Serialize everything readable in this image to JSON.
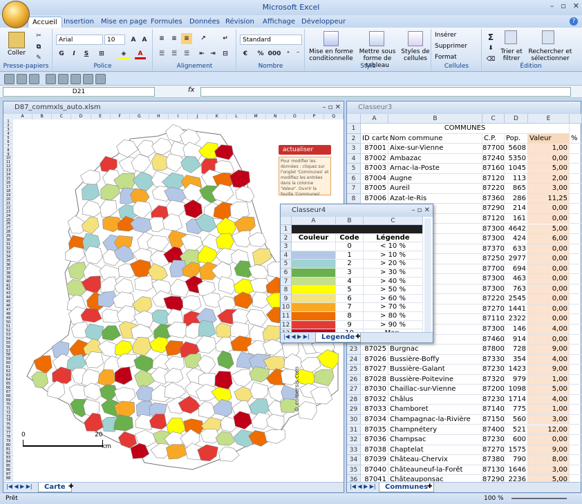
{
  "app": {
    "title": "Microsoft Excel"
  },
  "ribbon_tabs": [
    "Accueil",
    "Insertion",
    "Mise en page",
    "Formules",
    "Données",
    "Révision",
    "Affichage",
    "Développeur"
  ],
  "ribbon": {
    "clipboard": {
      "paste": "Coller",
      "label": "Presse-papiers"
    },
    "font": {
      "name": "Arial",
      "size": "10",
      "label": "Police",
      "bold": "G",
      "italic": "I",
      "underline": "S"
    },
    "alignment": {
      "label": "Alignement"
    },
    "number": {
      "format": "Standard",
      "label": "Nombre",
      "percent": "%",
      "thousands": "000"
    },
    "style": {
      "cond_format": "Mise en forme conditionnelle",
      "table_format": "Mettre sous forme de tableau",
      "cell_styles": "Styles de cellules",
      "label": "Style"
    },
    "cells": {
      "insert": "Insérer",
      "delete": "Supprimer",
      "format": "Format",
      "label": "Cellules"
    },
    "editing": {
      "sort": "Trier et filtrer",
      "find": "Rechercher et sélectionner",
      "sum": "Σ",
      "label": "Édition"
    }
  },
  "formula_bar": {
    "name_box": "D21",
    "fx": "fx"
  },
  "map_window": {
    "title": "D87_commxls_auto.xlsm",
    "sheet_tab": "Carte",
    "refresh_button": "actualiser",
    "refresh_note": "Pour modifier les données : cliquez sur l'onglet 'Communes' et modifiez les entrées dans la colonne 'Valeur'. Ouvrir la feuille 'Communes'",
    "scale": {
      "zero": "0",
      "twenty": "20",
      "unit": "km"
    },
    "copyright": "© comersis.com",
    "columns": [
      "A",
      "B",
      "C",
      "D",
      "E",
      "F",
      "G",
      "H",
      "I",
      "J",
      "K",
      "L",
      "M",
      "N",
      "O",
      "P",
      "Q"
    ],
    "rows": [
      "1",
      "2",
      "3",
      "4",
      "5",
      "6",
      "7",
      "8",
      "9",
      "10",
      "11",
      "12",
      "13",
      "14",
      "15",
      "16",
      "17",
      "18",
      "19",
      "20",
      "21",
      "22",
      "23",
      "24",
      "25",
      "26",
      "27",
      "28",
      "29",
      "30",
      "31",
      "32",
      "33",
      "34",
      "35",
      "36",
      "37",
      "38",
      "39",
      "40",
      "41",
      "42",
      "43",
      "44",
      "45",
      "46",
      "47",
      "48",
      "49",
      "50",
      "51",
      "52",
      "53",
      "54",
      "55",
      "56",
      "57",
      "58",
      "59",
      "60",
      "61",
      "62",
      "63",
      "64",
      "65",
      "66",
      "67",
      "68",
      "69",
      "70",
      "71",
      "72",
      "73",
      "74",
      "75",
      "76",
      "77",
      "78",
      "79",
      "80",
      "81",
      "82",
      "83",
      "84",
      "85",
      "86",
      "87",
      "88"
    ]
  },
  "communes_window": {
    "title": "Classeur3",
    "sheet_tab": "Communes",
    "columns": [
      "A",
      "B",
      "C",
      "D",
      "E"
    ],
    "title_row": "COMMUNES",
    "headers": [
      "ID carte",
      "Nom commune",
      "C.P.",
      "Pop.",
      "Valeur",
      "%"
    ],
    "rows": [
      [
        "3",
        "87001",
        "Aixe-sur-Vienne",
        "87700",
        "5608",
        "1,00"
      ],
      [
        "4",
        "87002",
        "Ambazac",
        "87240",
        "5350",
        "0,00"
      ],
      [
        "5",
        "87003",
        "Arnac-la-Poste",
        "87160",
        "1045",
        "5,00"
      ],
      [
        "6",
        "87004",
        "Augne",
        "87120",
        "113",
        "2,00"
      ],
      [
        "7",
        "87005",
        "Aureil",
        "87220",
        "865",
        "3,00"
      ],
      [
        "8",
        "87006",
        "Azat-le-Ris",
        "87360",
        "286",
        "11,25"
      ],
      [
        "9",
        "",
        "",
        "87290",
        "214",
        "0,00"
      ],
      [
        "10",
        "",
        "-Lac",
        "87120",
        "161",
        "0,00"
      ],
      [
        "11",
        "",
        "",
        "87300",
        "4642",
        "5,00"
      ],
      [
        "12",
        "",
        "",
        "87300",
        "424",
        "6,00"
      ],
      [
        "13",
        "",
        "valier",
        "87370",
        "633",
        "0,00"
      ],
      [
        "14",
        "",
        "Gartempe",
        "87250",
        "2977",
        "0,00"
      ],
      [
        "15",
        "",
        "",
        "87700",
        "694",
        "0,00"
      ],
      [
        "16",
        "",
        "",
        "87300",
        "463",
        "0,00"
      ],
      [
        "17",
        "",
        "",
        "87300",
        "763",
        "0,00"
      ],
      [
        "18",
        "",
        "",
        "87220",
        "2545",
        "0,00"
      ],
      [
        "19",
        "",
        "te",
        "87270",
        "1441",
        "0,00"
      ],
      [
        "20",
        "",
        "ille",
        "87110",
        "2322",
        "0,00"
      ],
      [
        "21",
        "",
        "",
        "87300",
        "146",
        "4,00"
      ],
      [
        "22",
        "",
        "",
        "87460",
        "914",
        "0,00"
      ],
      [
        "23",
        "87025",
        "Burgnac",
        "87800",
        "728",
        "9,00"
      ],
      [
        "24",
        "87026",
        "Bussière-Boffy",
        "87330",
        "354",
        "4,00"
      ],
      [
        "25",
        "87027",
        "Bussière-Galant",
        "87230",
        "1423",
        "9,00"
      ],
      [
        "26",
        "87028",
        "Bussière-Poitevine",
        "87320",
        "979",
        "1,00"
      ],
      [
        "27",
        "87030",
        "Chaillac-sur-Vienne",
        "87200",
        "1098",
        "5,00"
      ],
      [
        "28",
        "87032",
        "Châlus",
        "87230",
        "1714",
        "4,00"
      ],
      [
        "29",
        "87033",
        "Chamboret",
        "87140",
        "775",
        "1,00"
      ],
      [
        "30",
        "87034",
        "Champagnac-la-Rivière",
        "87150",
        "560",
        "3,00"
      ],
      [
        "31",
        "87035",
        "Champnétery",
        "87400",
        "521",
        "12,00"
      ],
      [
        "32",
        "87036",
        "Champsac",
        "87230",
        "600",
        "0,00"
      ],
      [
        "33",
        "87038",
        "Chaptelat",
        "87270",
        "1575",
        "9,00"
      ],
      [
        "34",
        "87039",
        "Château-Chervix",
        "87380",
        "790",
        "8,00"
      ],
      [
        "35",
        "87040",
        "Châteauneuf-la-Forêt",
        "87130",
        "1646",
        "3,00"
      ],
      [
        "36",
        "87041",
        "Châteauponsac",
        "87290",
        "2236",
        "5,00"
      ]
    ]
  },
  "legend_window": {
    "title": "Classeur4",
    "sheet_tab": "Legende",
    "columns": [
      "A",
      "B",
      "C"
    ],
    "headers": [
      "Couleur",
      "Code",
      "Légende"
    ],
    "rows": [
      {
        "row": "2",
        "code": "0",
        "label": "< 10 %",
        "color": "#ffffff"
      },
      {
        "row": "3",
        "code": "1",
        "label": "> 10 %",
        "color": "#b4c7e7"
      },
      {
        "row": "4",
        "code": "2",
        "label": "> 20 %",
        "color": "#9fd3d3"
      },
      {
        "row": "5",
        "code": "3",
        "label": "> 30 %",
        "color": "#6ab04c"
      },
      {
        "row": "6",
        "code": "4",
        "label": "> 40 %",
        "color": "#c4df8a"
      },
      {
        "row": "7",
        "code": "5",
        "label": "> 50 %",
        "color": "#ffff00"
      },
      {
        "row": "8",
        "code": "6",
        "label": "> 60 %",
        "color": "#f6e27a"
      },
      {
        "row": "9",
        "code": "7",
        "label": "> 70 %",
        "color": "#f9a825"
      },
      {
        "row": "10",
        "code": "8",
        "label": "> 80 %",
        "color": "#ef6c00"
      },
      {
        "row": "11",
        "code": "9",
        "label": "> 90 %",
        "color": "#e53935"
      },
      {
        "row": "12",
        "code": "10",
        "label": "Max.",
        "color": "#c00018"
      }
    ]
  },
  "status": {
    "ready": "Prêt",
    "zoom": "100 %"
  }
}
